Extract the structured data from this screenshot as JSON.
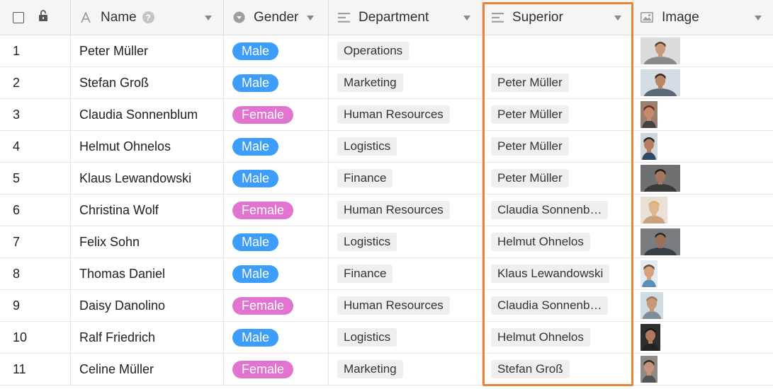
{
  "columns": {
    "name": "Name",
    "gender": "Gender",
    "department": "Department",
    "superior": "Superior",
    "image": "Image"
  },
  "colors": {
    "male": "#3d9dfa",
    "female": "#e074cf",
    "highlight": "#e8833a",
    "header_bg": "#f5f5f5",
    "tag_bg": "#efefef"
  },
  "header_icons": {
    "select": "checkbox-icon",
    "lock": "lock-icon",
    "name": "text-letter-a-icon",
    "name_help": "help-icon",
    "gender": "single-select-icon",
    "department": "link-lines-icon",
    "superior": "link-lines-icon",
    "image": "image-icon",
    "menu": "chevron-down-icon"
  },
  "rows": [
    {
      "idx": "1",
      "name": "Peter Müller",
      "gender": "Male",
      "department": "Operations",
      "superior": "",
      "photo": {
        "w": 56,
        "skin": "#c99a7b",
        "hair": "#5a4030",
        "shirt": "#8a8a8a",
        "bg": "#dcdcdc"
      }
    },
    {
      "idx": "2",
      "name": "Stefan Groß",
      "gender": "Male",
      "department": "Marketing",
      "superior": "Peter Müller",
      "photo": {
        "w": 56,
        "skin": "#b88466",
        "hair": "#3a2a20",
        "shirt": "#5a6a78",
        "bg": "#d6dde2"
      }
    },
    {
      "idx": "3",
      "name": "Claudia Sonnenblum",
      "gender": "Female",
      "department": "Human Resources",
      "superior": "Peter Müller",
      "photo": {
        "w": 24,
        "skin": "#c78a6a",
        "hair": "#6b2f22",
        "shirt": "#444444",
        "bg": "#9a8070"
      }
    },
    {
      "idx": "4",
      "name": "Helmut Ohnelos",
      "gender": "Male",
      "department": "Logistics",
      "superior": "Peter Müller",
      "photo": {
        "w": 24,
        "skin": "#b57d5e",
        "hair": "#2a2622",
        "shirt": "#2b4a66",
        "bg": "#cfd6dc"
      }
    },
    {
      "idx": "5",
      "name": "Klaus Lewandowski",
      "gender": "Male",
      "department": "Finance",
      "superior": "Peter Müller",
      "photo": {
        "w": 56,
        "skin": "#a7765a",
        "hair": "#1f1a18",
        "shirt": "#3a3a3a",
        "bg": "#6e7072"
      }
    },
    {
      "idx": "6",
      "name": "Christina Wolf",
      "gender": "Female",
      "department": "Human Resources",
      "superior": "Claudia Sonnenblum",
      "photo": {
        "w": 38,
        "skin": "#e2b48f",
        "hair": "#d8b26e",
        "shirt": "#c7a27c",
        "bg": "#e9e1d7"
      }
    },
    {
      "idx": "7",
      "name": "Felix Sohn",
      "gender": "Male",
      "department": "Logistics",
      "superior": "Helmut Ohnelos",
      "photo": {
        "w": 56,
        "skin": "#a06e55",
        "hair": "#2a2a2a",
        "shirt": "#3a3f44",
        "bg": "#7a7d80"
      }
    },
    {
      "idx": "8",
      "name": "Thomas Daniel",
      "gender": "Male",
      "department": "Finance",
      "superior": "Klaus Lewandowski",
      "photo": {
        "w": 24,
        "skin": "#d9a27e",
        "hair": "#6e4a2e",
        "shirt": "#5d8fb8",
        "bg": "#e3ecf2"
      }
    },
    {
      "idx": "9",
      "name": "Daisy Danolino",
      "gender": "Female",
      "department": "Human Resources",
      "superior": "Claudia Sonnenblum",
      "photo": {
        "w": 32,
        "skin": "#c99676",
        "hair": "#9b7a5a",
        "shirt": "#7d8f95",
        "bg": "#cfdde2"
      }
    },
    {
      "idx": "10",
      "name": "Ralf Friedrich",
      "gender": "Male",
      "department": "Logistics",
      "superior": "Helmut Ohnelos",
      "photo": {
        "w": 28,
        "skin": "#b07b5e",
        "hair": "#1c1a18",
        "shirt": "#222222",
        "bg": "#2e2e2e"
      }
    },
    {
      "idx": "11",
      "name": "Celine Müller",
      "gender": "Female",
      "department": "Marketing",
      "superior": "Stefan Groß",
      "photo": {
        "w": 24,
        "skin": "#c8937a",
        "hair": "#3a2a22",
        "shirt": "#555555",
        "bg": "#8e8a88"
      }
    }
  ]
}
